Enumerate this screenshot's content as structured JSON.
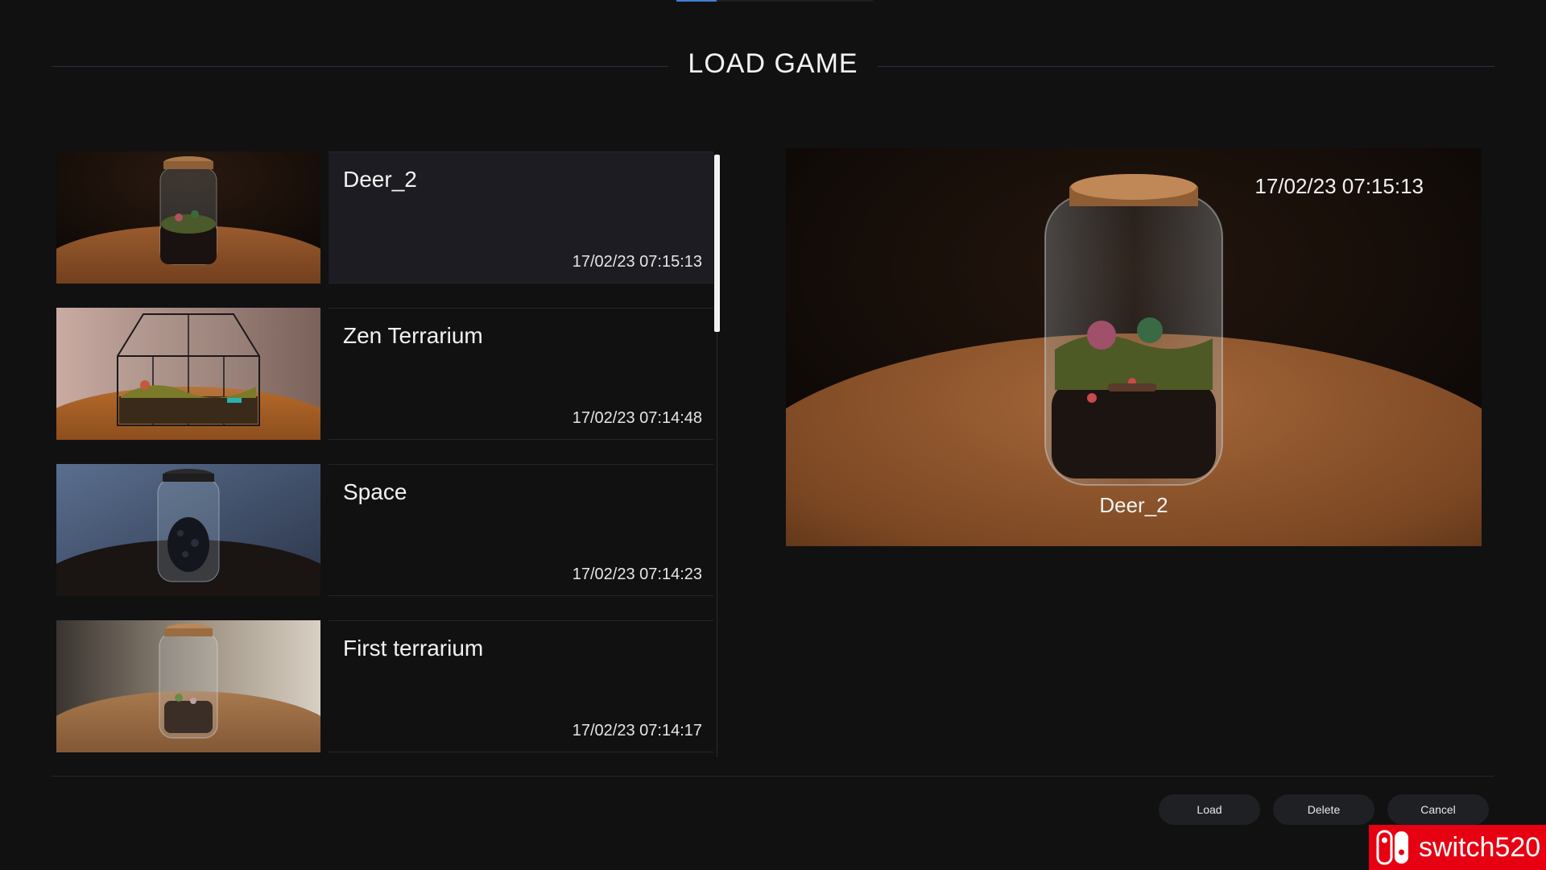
{
  "header": {
    "title": "LOAD GAME"
  },
  "saves": [
    {
      "name": "Deer_2",
      "date": "17/02/23 07:15:13",
      "selected": true
    },
    {
      "name": "Zen Terrarium",
      "date": "17/02/23 07:14:48",
      "selected": false
    },
    {
      "name": "Space",
      "date": "17/02/23 07:14:23",
      "selected": false
    },
    {
      "name": "First terrarium",
      "date": "17/02/23 07:14:17",
      "selected": false
    }
  ],
  "preview": {
    "name": "Deer_2",
    "date": "17/02/23 07:15:13"
  },
  "buttons": {
    "load": "Load",
    "delete": "Delete",
    "cancel": "Cancel"
  },
  "watermark": {
    "text": "switch520"
  },
  "colors": {
    "accent": "#3f7fd6",
    "background": "#111112",
    "watermark": "#e60012"
  }
}
